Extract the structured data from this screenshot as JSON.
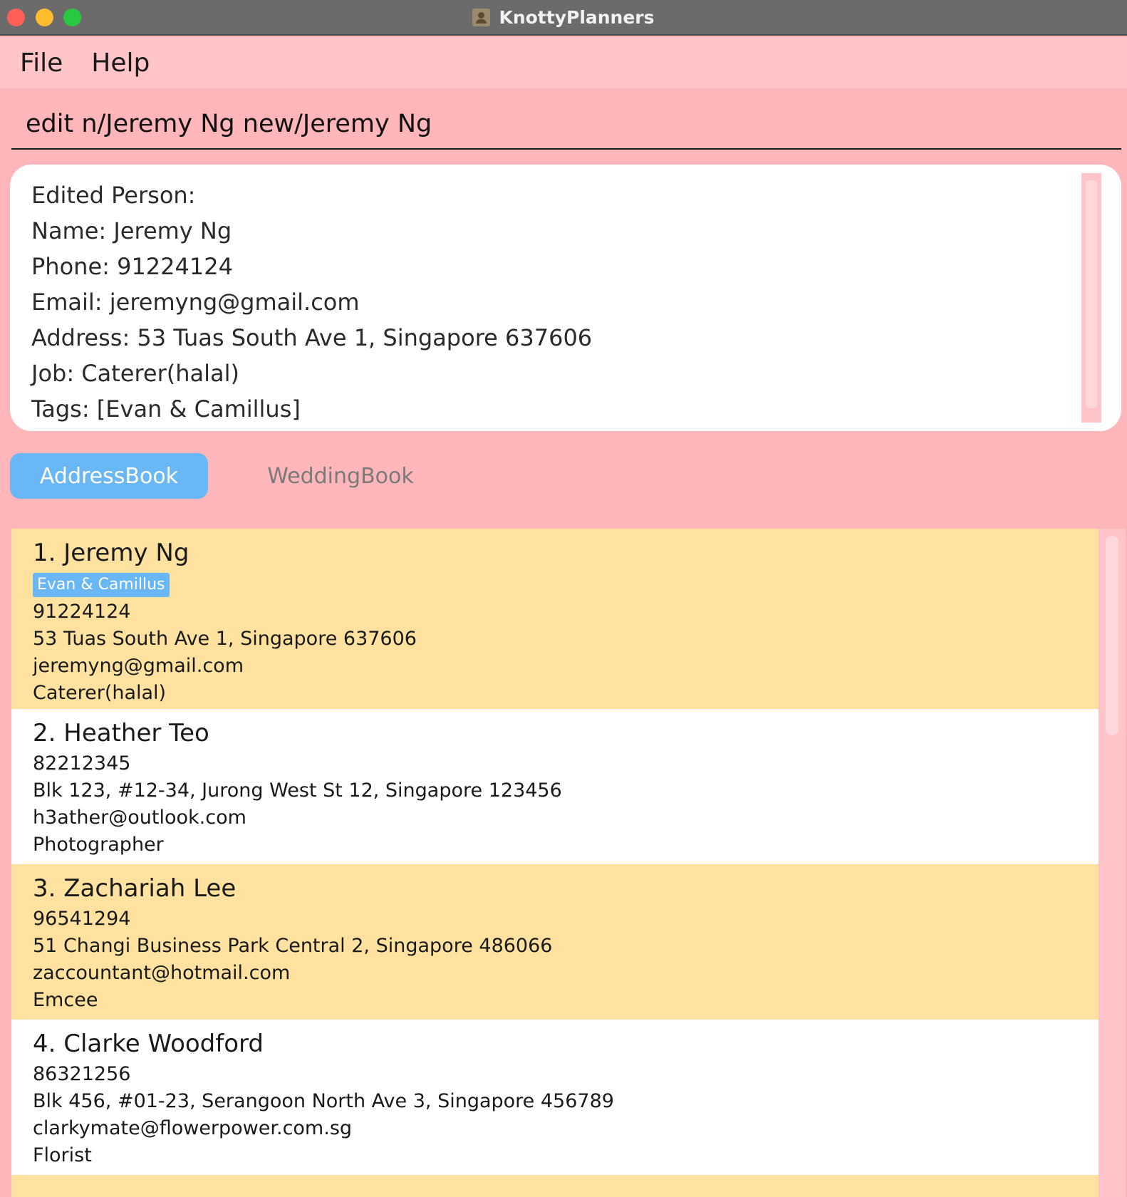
{
  "window": {
    "title": "KnottyPlanners"
  },
  "menu": {
    "items": [
      "File",
      "Help"
    ]
  },
  "command": {
    "value": "edit n/Jeremy Ng new/Jeremy Ng"
  },
  "result": {
    "lines": [
      "Edited Person:",
      "Name: Jeremy Ng",
      "Phone: 91224124",
      "Email: jeremyng@gmail.com",
      "Address: 53 Tuas South Ave 1, Singapore 637606",
      "Job: Caterer(halal)",
      "Tags: [Evan & Camillus]"
    ]
  },
  "tabs": {
    "address_book": "AddressBook",
    "wedding_book": "WeddingBook",
    "active": "AddressBook"
  },
  "persons": [
    {
      "heading": "1. Jeremy Ng",
      "tag": "Evan & Camillus",
      "phone": "91224124",
      "address": "53 Tuas South Ave 1, Singapore 637606",
      "email": "jeremyng@gmail.com",
      "job": "Caterer(halal)"
    },
    {
      "heading": "2. Heather Teo",
      "phone": "82212345",
      "address": "Blk 123, #12-34, Jurong West St 12, Singapore 123456",
      "email": "h3ather@outlook.com",
      "job": "Photographer"
    },
    {
      "heading": "3. Zachariah Lee",
      "phone": "96541294",
      "address": "51 Changi Business Park Central 2, Singapore 486066",
      "email": "zaccountant@hotmail.com",
      "job": "Emcee"
    },
    {
      "heading": "4. Clarke Woodford",
      "phone": "86321256",
      "address": "Blk 456, #01-23, Serangoon North Ave 3, Singapore 456789",
      "email": "clarkymate@flowerpower.com.sg",
      "job": "Florist"
    }
  ],
  "colors": {
    "background": "#ffb6bb",
    "menubar": "#ffc4c8",
    "card_alt": "#ffe29f",
    "accent": "#6ab7f5"
  }
}
